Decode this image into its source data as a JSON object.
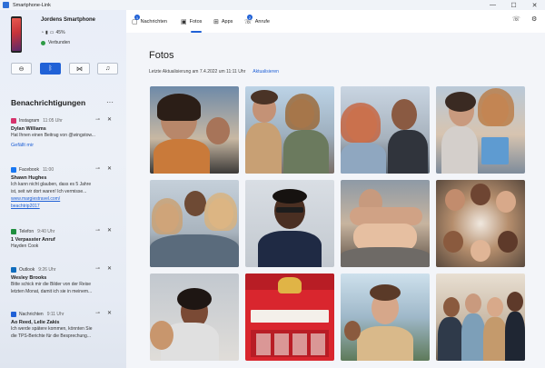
{
  "window": {
    "title": "Smartphone-Link",
    "controls": {
      "minimize": "—",
      "maximize": "☐",
      "close": "✕"
    }
  },
  "device": {
    "name": "Jordens Smartphone",
    "status": "45%",
    "connection": "Verbunden"
  },
  "quick_actions": [
    {
      "icon": "do-not-disturb-icon",
      "glyph": "⊖",
      "active": false
    },
    {
      "icon": "bluetooth-icon",
      "glyph": "ᛒ",
      "active": true
    },
    {
      "icon": "audio-routing-icon",
      "glyph": "⋈",
      "active": false
    },
    {
      "icon": "music-icon",
      "glyph": "♫",
      "active": false
    }
  ],
  "notifications": {
    "title": "Benachrichtigungen",
    "more": "···",
    "items": [
      {
        "app": "Instagram",
        "time": "11:05 Uhr",
        "sender": "Dylan Williams",
        "text": [
          "Hat Ihnen einen Beitrag von @wingstow..."
        ],
        "action": "Gefällt mir",
        "color": "#d6336c"
      },
      {
        "app": "Facebook",
        "time": "11:00",
        "sender": "Shawn Hughes",
        "text": [
          "Ich kann nicht glauben, dass es 5 Jahre",
          "ist, seit wir dort waren! Ich vermisse...",
          "www.margiestravel.com/",
          "beachtrip2017"
        ],
        "action": "",
        "color": "#1877f2"
      },
      {
        "app": "Telefon",
        "time": "9:40 Uhr",
        "sender": "1 Verpasster Anruf",
        "text": [
          "Hayden Cook"
        ],
        "action": "",
        "color": "#1e8e3e"
      },
      {
        "app": "Outlook",
        "time": "9:26 Uhr",
        "sender": "Wesley Brooks",
        "text": [
          "Bitte schick mir die Bilder von der Reise",
          "letzten Monat, damit ich sie in meinem..."
        ],
        "action": "",
        "color": "#0f6cbd"
      },
      {
        "app": "Nachrichten",
        "time": "9:11 Uhr",
        "sender": "Ao Reed, Lelie Zakis",
        "text": [
          "Ich werde spätere kommen, könnten Sie",
          "die TPS-Berichte für die Besprechung..."
        ],
        "action": "",
        "color": "#2061d6"
      }
    ]
  },
  "tabs": [
    {
      "label": "Nachrichten",
      "icon": "messages-icon",
      "glyph": "▢",
      "badge": "1"
    },
    {
      "label": "Fotos",
      "icon": "photos-icon",
      "glyph": "▣",
      "badge": ""
    },
    {
      "label": "Apps",
      "icon": "apps-icon",
      "glyph": "⊞",
      "badge": ""
    },
    {
      "label": "Anrufe",
      "icon": "calls-icon",
      "glyph": "☏",
      "badge": "2"
    }
  ],
  "toolbar": {
    "call_glyph": "☏",
    "settings_glyph": "⚙"
  },
  "photos_page": {
    "title": "Fotos",
    "updated": "Letzte Aktualisierung am 7.4.2022 um 11:11 Uhr",
    "refresh": "Aktualisieren"
  },
  "colors": {
    "accent": "#2061d6",
    "sidebar": "#e9eef8",
    "main": "#f3f5f9"
  }
}
